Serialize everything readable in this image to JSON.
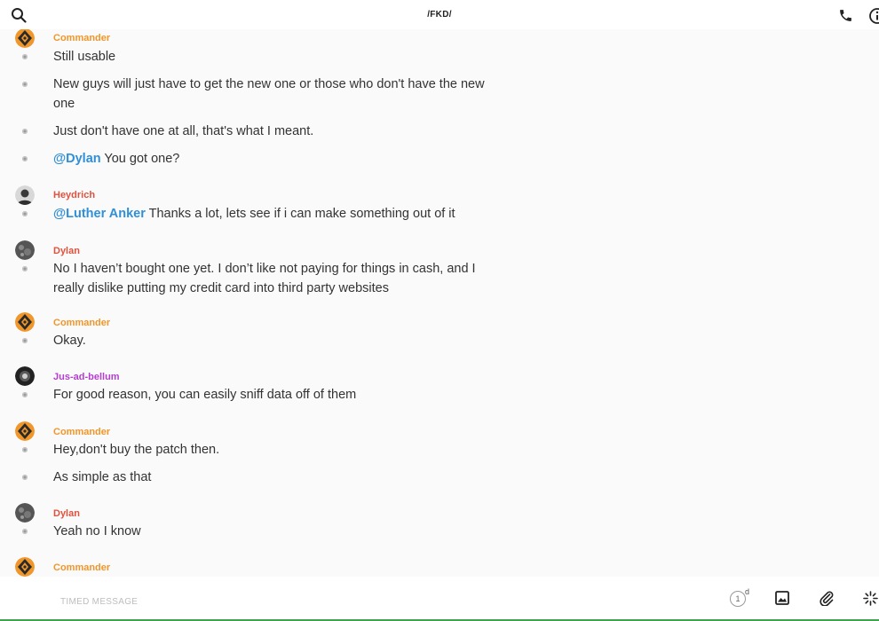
{
  "header": {
    "title": "/FKD/",
    "icons": {
      "search": "search-icon",
      "call": "phone-icon",
      "info": "info-icon"
    }
  },
  "colors": {
    "mention": "#2f8fd8",
    "commander": "#f0962a",
    "heydrich": "#e0513f",
    "dylan": "#e0513f",
    "jus_ad_bellum": "#b43fcf"
  },
  "messages": [
    {
      "sender": "Commander",
      "texts": [
        {
          "plain": "Still usable"
        },
        {
          "plain": "New guys will just have to get the new one or those who don't have the new one"
        },
        {
          "plain": "Just don't have one at all, that's what I meant."
        },
        {
          "mention": "@Dylan",
          "plain": " You got one?"
        }
      ]
    },
    {
      "sender": "Heydrich",
      "texts": [
        {
          "mention": "@Luther Anker",
          "plain": " Thanks a lot, lets see if i can make something out of it"
        }
      ]
    },
    {
      "sender": "Dylan",
      "texts": [
        {
          "plain": "No I haven’t bought one yet. I don’t like not paying for things in cash, and I really dislike putting my credit card into third party websites"
        }
      ]
    },
    {
      "sender": "Commander",
      "texts": [
        {
          "plain": "Okay."
        }
      ]
    },
    {
      "sender": "Jus-ad-bellum",
      "texts": [
        {
          "plain": "For good reason, you can easily sniff data off of them"
        }
      ]
    },
    {
      "sender": "Commander",
      "texts": [
        {
          "plain": "Hey,don't buy the patch then."
        },
        {
          "plain": "As simple as that"
        }
      ]
    },
    {
      "sender": "Dylan",
      "texts": [
        {
          "plain": "Yeah no I know"
        }
      ]
    },
    {
      "sender": "Commander",
      "texts": []
    }
  ],
  "composer": {
    "placeholder": "TIMED MESSAGE",
    "timer_value": "1",
    "timer_unit": "d",
    "icons": {
      "image": "image-icon",
      "attach": "paperclip-icon",
      "more": "sparkle-icon"
    }
  }
}
